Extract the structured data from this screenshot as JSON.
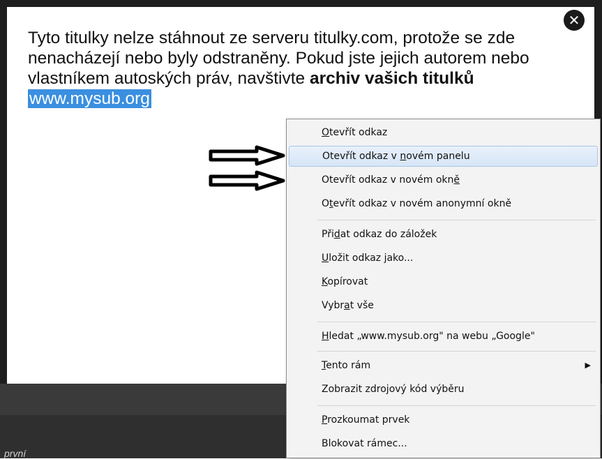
{
  "dialog": {
    "close_label": "✕",
    "message_part1": "Tyto titulky nelze stáhnout ze serveru titulky.com, protože se zde nenacházejí nebo byly odstraněny. Pokud jste jejich autorem nebo vlastníkem autoských práv, navštivte ",
    "message_bold": "archiv vašich titulků",
    "link_text": "www.mysub.org"
  },
  "background": {
    "bottom_text": "první"
  },
  "context_menu": {
    "items": [
      {
        "pre": "",
        "key": "O",
        "post": "tevřít odkaz"
      },
      {
        "pre": "Otevřít odkaz v ",
        "key": "n",
        "post": "ovém panelu"
      },
      {
        "pre": "Otevřít odkaz v novém okn",
        "key": "ě",
        "post": ""
      },
      {
        "pre": "O",
        "key": "t",
        "post": "evřít odkaz v novém anonymní okně"
      },
      {
        "pre": "Při",
        "key": "d",
        "post": "at odkaz do záložek"
      },
      {
        "pre": "",
        "key": "U",
        "post": "ložit odkaz jako..."
      },
      {
        "pre": "",
        "key": "K",
        "post": "opírovat"
      },
      {
        "pre": "Vybr",
        "key": "a",
        "post": "t vše"
      },
      {
        "pre": "",
        "key": "H",
        "post": "ledat „www.mysub.org\" na webu „Google\""
      },
      {
        "pre": "",
        "key": "T",
        "post": "ento rám"
      },
      {
        "pre": "Zobrazit zdrojový kód výběru",
        "key": "",
        "post": ""
      },
      {
        "pre": "",
        "key": "P",
        "post": "rozkoumat prvek"
      },
      {
        "pre": "Blokovat rámec...",
        "key": "",
        "post": ""
      }
    ],
    "submenu_arrow": "▶"
  }
}
